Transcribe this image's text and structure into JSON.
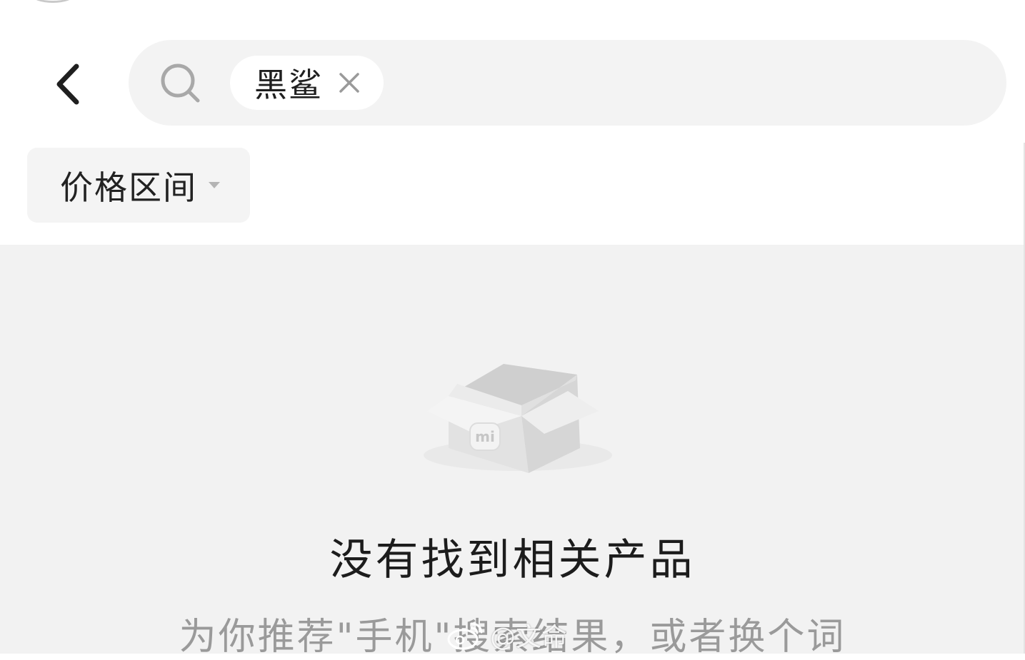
{
  "header": {
    "search_chip_text": "黑鲨",
    "search_input_value": "",
    "icons": {
      "back": "chevron-left-icon",
      "search": "search-icon",
      "chip_close": "close-icon"
    }
  },
  "filters": {
    "price_range_label": "价格区间",
    "caret_icon": "caret-down-icon"
  },
  "empty_state": {
    "illustration": "empty-box-mi-icon",
    "title": "没有找到相关产品",
    "subtitle": "为你推荐\"手机\"搜索结果，或者换个词"
  },
  "watermark": {
    "icon": "weibo-icon",
    "text": "@文命"
  },
  "colors": {
    "page_bg": "#ffffff",
    "search_bar_bg": "#f3f3f3",
    "content_bg": "#f2f2f2",
    "title_text": "#1c1c1c",
    "subtitle_text": "#9a9a9a"
  }
}
